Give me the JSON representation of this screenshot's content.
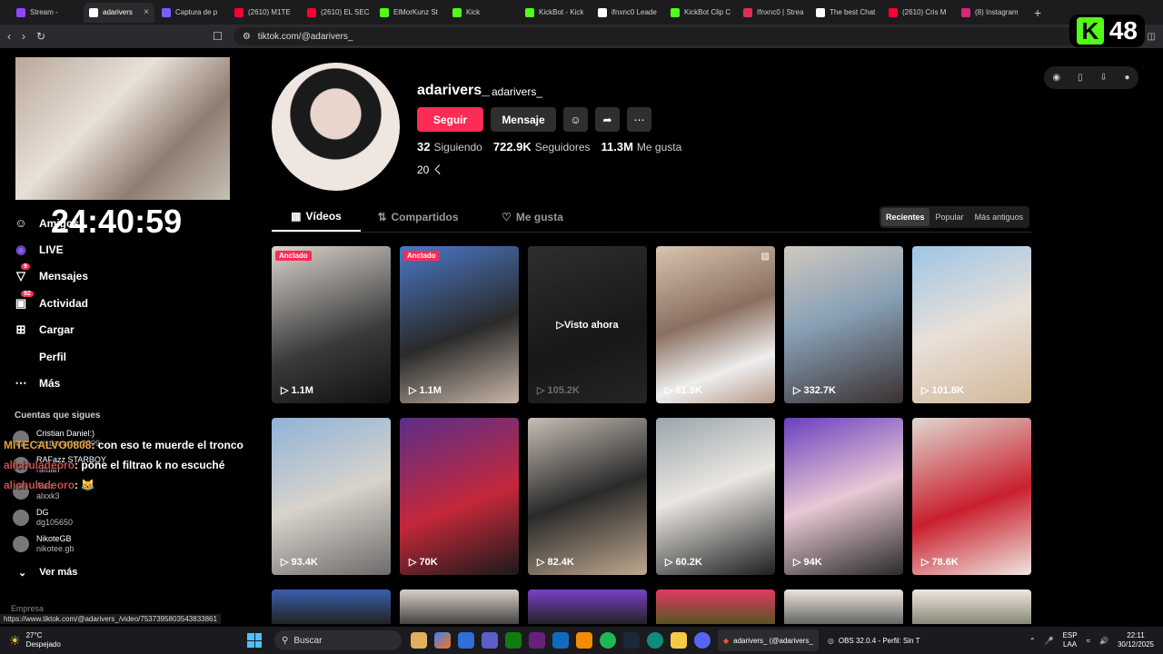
{
  "browser": {
    "tabs": [
      {
        "title": "Stream -",
        "color": "#9146ff",
        "active": false
      },
      {
        "title": "adarivers",
        "color": "#ffffff",
        "active": true
      },
      {
        "title": "Captura de p",
        "color": "#7b5cff",
        "active": false
      },
      {
        "title": "(2610) M1TE",
        "color": "#ff0033",
        "active": false
      },
      {
        "title": "(2610) EL SEC",
        "color": "#ff0033",
        "active": false
      },
      {
        "title": "ElMorKunz St",
        "color": "#53fc18",
        "active": false
      },
      {
        "title": "Kick",
        "color": "#53fc18",
        "active": false
      },
      {
        "title": "KickBot - Kick",
        "color": "#53fc18",
        "active": false
      },
      {
        "title": "ifnxnc0 Leade",
        "color": "#ffffff",
        "active": false
      },
      {
        "title": "KickBot Clip C",
        "color": "#53fc18",
        "active": false
      },
      {
        "title": "Ifnxnc0 | Strea",
        "color": "#e03050",
        "active": false
      },
      {
        "title": "The best Chat",
        "color": "#ffffff",
        "active": false
      },
      {
        "title": "(2610) Cris M",
        "color": "#ff0033",
        "active": false
      },
      {
        "title": "(8) Instagram",
        "color": "#d62976",
        "active": false
      }
    ],
    "new_tab": "+",
    "url": "tiktok.com/@adarivers_",
    "kick_counter": "48"
  },
  "stream": {
    "timer": "24:40:59",
    "chat": [
      {
        "user": "MITECALVO0808",
        "text": ": con eso te muerde el tronco"
      },
      {
        "user": "alichuladeoro",
        "text": ": pone el filtrao k no escuché"
      },
      {
        "user": "alichuladeoro",
        "text": ": 😹"
      }
    ]
  },
  "sidebar": {
    "items": [
      {
        "label": "Amigos",
        "icon": "users-icon"
      },
      {
        "label": "LIVE",
        "icon": "live-icon"
      },
      {
        "label": "Mensajes",
        "icon": "send-icon",
        "badge": "9"
      },
      {
        "label": "Actividad",
        "icon": "inbox-icon",
        "badge": "92"
      },
      {
        "label": "Cargar",
        "icon": "upload-icon"
      },
      {
        "label": "Perfil",
        "icon": "profile-icon"
      },
      {
        "label": "Más",
        "icon": "more-icon"
      }
    ],
    "following_title": "Cuentas que sigues",
    "following": [
      {
        "name": "Cristian Daniel:)",
        "user": "cristianvalen2009"
      },
      {
        "name": "RAFazz STARBOY",
        "user": "rafuan"
      },
      {
        "name": "Alex",
        "user": "alxxk3"
      },
      {
        "name": "DG",
        "user": "dg105650"
      },
      {
        "name": "NikoteGB",
        "user": "nikotee.gb"
      }
    ],
    "see_more": "Ver más",
    "company": "Empresa"
  },
  "profile": {
    "username": "adarivers_",
    "nickname": "adarivers_",
    "follow_label": "Seguir",
    "message_label": "Mensaje",
    "stats": [
      {
        "value": "32",
        "label": "Siguiendo"
      },
      {
        "value": "722.9K",
        "label": "Seguidores"
      },
      {
        "value": "11.3M",
        "label": "Me gusta"
      }
    ],
    "bio": "20 ㄑ"
  },
  "content_tabs": {
    "videos": "Vídeos",
    "reposts": "Compartidos",
    "likes": "Me gusta"
  },
  "sort": {
    "recent": "Recientes",
    "popular": "Popular",
    "oldest": "Más antiguos"
  },
  "videos": [
    {
      "views": "1.1M",
      "pinned": "Anclado",
      "bg": "linear-gradient(160deg,#d9d2cc,#3a3a3a 60%,#111)"
    },
    {
      "views": "1.1M",
      "pinned": "Anclado",
      "bg": "linear-gradient(160deg,#4a78c8,#2a2a2a 55%,#c9b7a8)"
    },
    {
      "views": "105.2K",
      "watched": "Visto ahora",
      "bg": "linear-gradient(160deg,#555,#2b2b2b 60%,#444)"
    },
    {
      "views": "81.9K",
      "bg": "linear-gradient(160deg,#d8c4b0,#8a6f60 45%,#eee 75%,#b59a8a)"
    },
    {
      "views": "332.7K",
      "bg": "linear-gradient(160deg,#cfc8c0,#88a0b5 45%,#3a3030)"
    },
    {
      "views": "101.8K",
      "bg": "linear-gradient(160deg,#9ec5e6,#e8e0d8 50%,#d2b89a)"
    },
    {
      "views": "93.4K",
      "bg": "linear-gradient(160deg,#8fb3d9,#d8d3cb 50%,#6d6a6a)"
    },
    {
      "views": "70K",
      "bg": "linear-gradient(160deg,#5b2e8a,#c4283a 55%,#1a1a1a)"
    },
    {
      "views": "82.4K",
      "bg": "linear-gradient(160deg,#c7bdb4,#2a2a2a 50%,#bfa88f)"
    },
    {
      "views": "60.2K",
      "bg": "linear-gradient(160deg,#9aa6ad,#eae6e1 45%,#1f1f1f)"
    },
    {
      "views": "94K",
      "bg": "linear-gradient(160deg,#6a3fc0,#e8c8d4 50%,#2a2a2a)"
    },
    {
      "views": "78.6K",
      "bg": "linear-gradient(160deg,#e0d8d0,#c91f2e 55%,#efe6df)"
    }
  ],
  "videos_row3": [
    {
      "bg": "linear-gradient(180deg,#3a5fb0,#222)"
    },
    {
      "bg": "linear-gradient(180deg,#d9cfc7,#444)"
    },
    {
      "bg": "linear-gradient(180deg,#7c3fc9,#222)"
    },
    {
      "bg": "linear-gradient(180deg,#e23a63,#552)"
    },
    {
      "bg": "linear-gradient(180deg,#ece4dd,#666)"
    },
    {
      "bg": "linear-gradient(180deg,#f0e6df,#887)"
    }
  ],
  "status_url": "https://www.tiktok.com/@adarivers_/video/7537395803543833861",
  "taskbar": {
    "temp": "27°C",
    "weather": "Despejado",
    "search": "Buscar",
    "windows": [
      {
        "label": "adarivers_ (@adarivers_",
        "active": true
      },
      {
        "label": "OBS 32.0.4 - Perfil: Sin T",
        "active": false
      }
    ],
    "lang1": "ESP",
    "lang2": "LAA",
    "time": "22:11",
    "date": "30/12/2025"
  }
}
